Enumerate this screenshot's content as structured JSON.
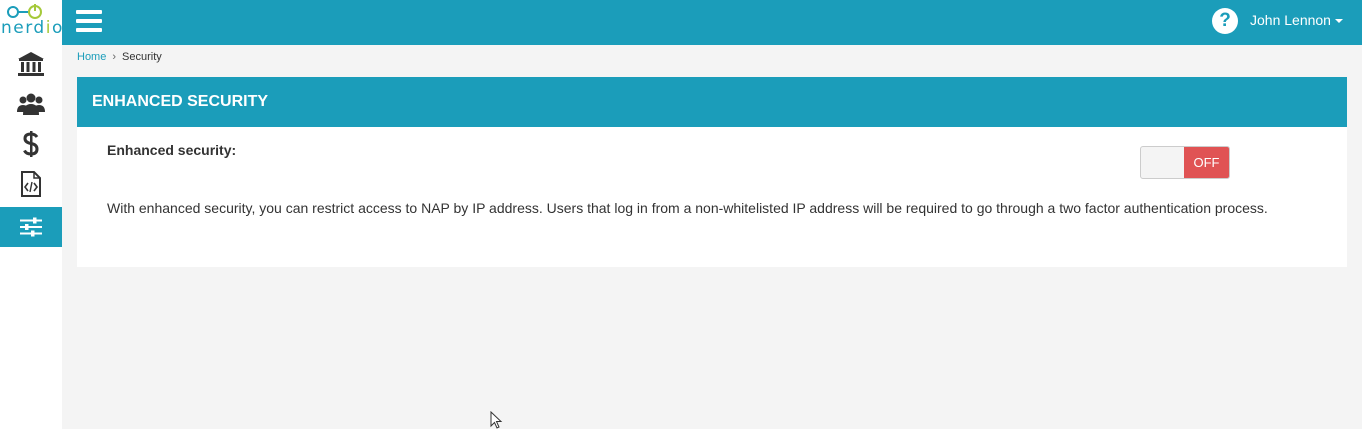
{
  "app": {
    "logo_text_left": "nerd",
    "logo_text_o": "i",
    "logo_text_right": "o"
  },
  "sidebar": {
    "items": [
      {
        "name": "bank-icon"
      },
      {
        "name": "users-icon"
      },
      {
        "name": "dollar-icon"
      },
      {
        "name": "code-file-icon"
      },
      {
        "name": "sliders-icon",
        "active": true
      }
    ]
  },
  "topbar": {
    "help_glyph": "?",
    "user_name": "John Lennon"
  },
  "breadcrumb": {
    "home": "Home",
    "separator": "›",
    "current": "Security"
  },
  "panel": {
    "title": "ENHANCED SECURITY",
    "field_label": "Enhanced security:",
    "toggle_state": "OFF",
    "description": "With enhanced security, you can restrict access to NAP by IP address. Users that log in from a non-whitelisted IP address will be required to go through a two factor authentication process."
  },
  "colors": {
    "accent": "#1b9dba",
    "logo_green": "#a5c93a",
    "toggle_off": "#e05354"
  }
}
